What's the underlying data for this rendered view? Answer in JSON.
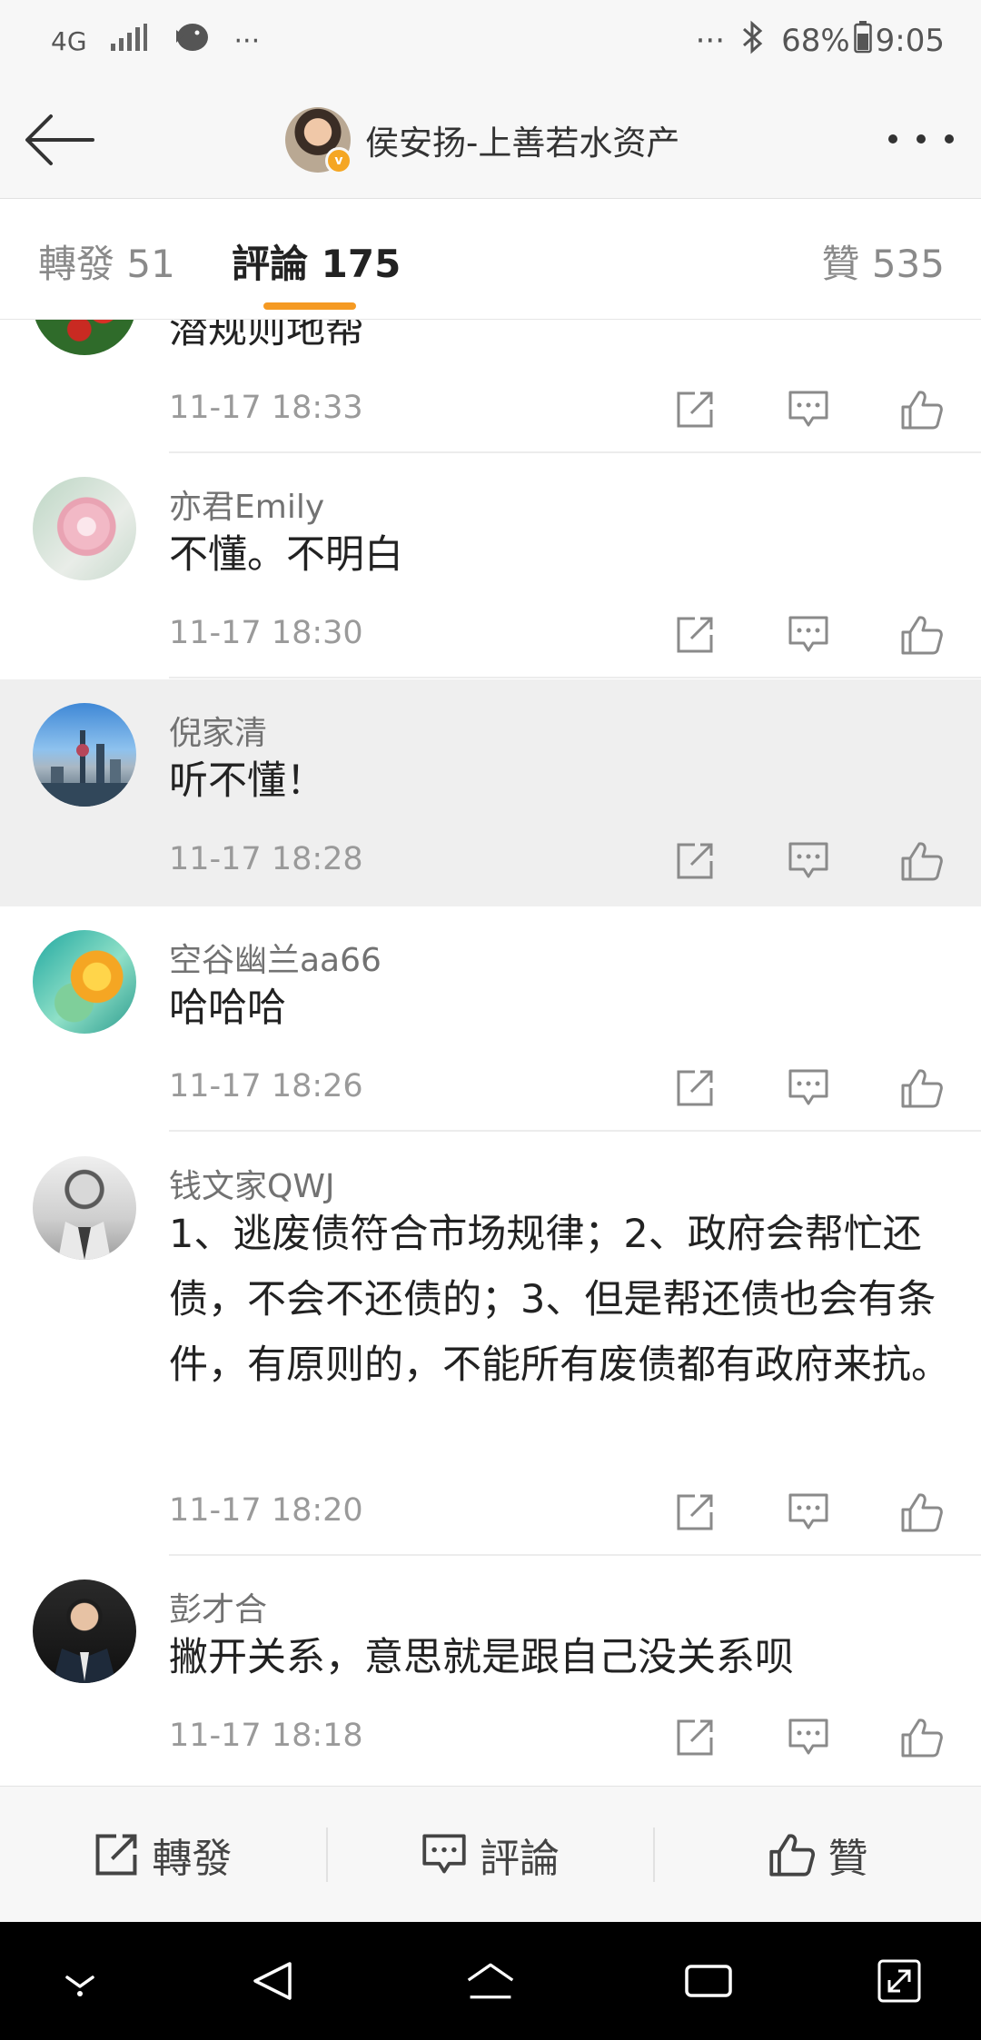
{
  "status_bar": {
    "network": "4G",
    "dots_left": "···",
    "dots_right": "···",
    "battery_percent": "68%",
    "time": "9:05"
  },
  "header": {
    "title": "侯安扬-上善若水资产",
    "verified_badge": "v"
  },
  "tabs": {
    "repost": {
      "label": "轉發",
      "count": "51"
    },
    "comments": {
      "label": "評論",
      "count": "175"
    },
    "likes": {
      "label": "贊",
      "count": "535"
    }
  },
  "comments": [
    {
      "name": "",
      "text": "潜规则地帮",
      "time": "11-17 18:33",
      "avatar": "red-roses"
    },
    {
      "name": "亦君Emily",
      "text": "不懂。不明白",
      "time": "11-17 18:30",
      "avatar": "pink-flower"
    },
    {
      "name": "倪家清",
      "text": "听不懂！",
      "time": "11-17 18:28",
      "avatar": "city-skyline"
    },
    {
      "name": "空谷幽兰aa66",
      "text": "哈哈哈",
      "time": "11-17 18:26",
      "avatar": "yellow-tulip"
    },
    {
      "name": "钱文家QWJ",
      "text": "1、逃废债符合市场规律；2、政府会帮忙还债，不会不还债的；3、但是帮还债也会有条件，有原则的，不能所有废债都有政府来抗。",
      "time": "11-17 18:20",
      "avatar": "man-suit-bw"
    },
    {
      "name": "彭才合",
      "text": "撇开关系，意思就是跟自己没关系呗",
      "time": "11-17 18:18",
      "avatar": "man-suit-dark"
    }
  ],
  "bottom_bar": {
    "repost_label": "轉發",
    "comment_label": "評論",
    "like_label": "贊"
  },
  "colors": {
    "accent": "#f59a23",
    "highlight_row": "#efefef",
    "bar_bg": "#f7f7f7"
  }
}
